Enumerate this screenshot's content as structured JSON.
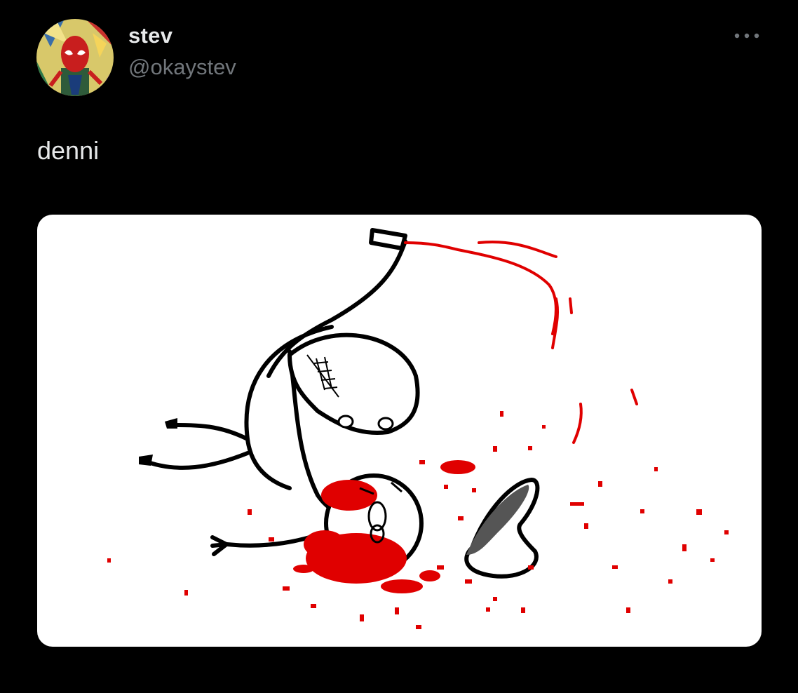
{
  "tweet": {
    "author": {
      "display_name": "stev",
      "handle": "@okaystev",
      "avatar_icon": "spiderman-avatar-icon"
    },
    "text": "denni",
    "more_icon": "more-options-icon",
    "media": {
      "kind": "drawing",
      "description_icon": "stick-figure-drawing",
      "colors": {
        "blood": "#e00000",
        "ink": "#000000",
        "background": "#ffffff"
      }
    }
  }
}
